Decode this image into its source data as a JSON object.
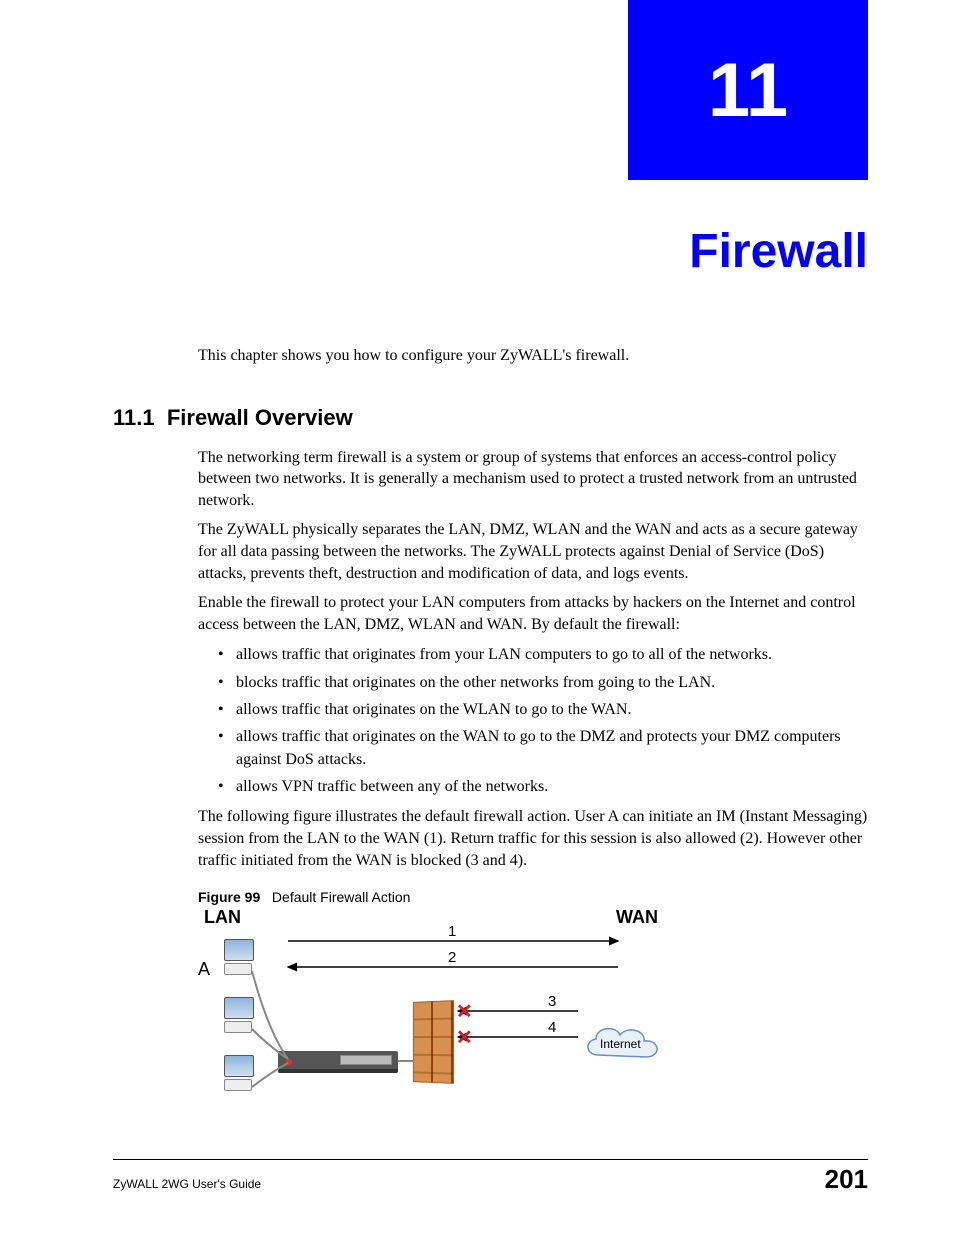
{
  "chapter": {
    "number": "11",
    "title": "Firewall"
  },
  "intro": "This chapter shows you how to configure your ZyWALL's firewall.",
  "section": {
    "number": "11.1",
    "title": "Firewall Overview"
  },
  "p1": "The networking term firewall is a system or group of systems that enforces an access-control policy between two networks. It is generally a mechanism used to protect a trusted network from an untrusted network.",
  "p2": "The ZyWALL physically separates the LAN, DMZ, WLAN and the WAN and acts as a secure gateway for all data passing between the networks. The ZyWALL protects against Denial of Service (DoS) attacks, prevents theft, destruction and modification of data, and logs events.",
  "p3": "Enable the firewall to protect your LAN computers from attacks by hackers on the Internet and control access between the LAN, DMZ, WLAN and WAN. By default the firewall:",
  "bullets": [
    "allows traffic that originates from your LAN computers to go to all of the networks.",
    "blocks traffic that originates on the other networks from going to the LAN.",
    "allows traffic that originates on the WLAN to go to the WAN.",
    "allows traffic that originates on the WAN to go to the DMZ and protects your DMZ computers against DoS attacks.",
    "allows VPN traffic between any of the networks."
  ],
  "p4": "The following figure illustrates the default firewall action. User A can initiate an IM (Instant Messaging) session from the LAN to the WAN (1). Return traffic for this session is also allowed (2). However other traffic initiated from the WAN is blocked (3 and 4).",
  "figure": {
    "label": "Figure 99",
    "caption": "Default Firewall Action",
    "lan_label": "LAN",
    "wan_label": "WAN",
    "user_label": "A",
    "arrow1": "1",
    "arrow2": "2",
    "arrow3": "3",
    "arrow4": "4",
    "cloud_label": "Internet"
  },
  "footer": {
    "guide": "ZyWALL 2WG User's Guide",
    "page": "201"
  }
}
